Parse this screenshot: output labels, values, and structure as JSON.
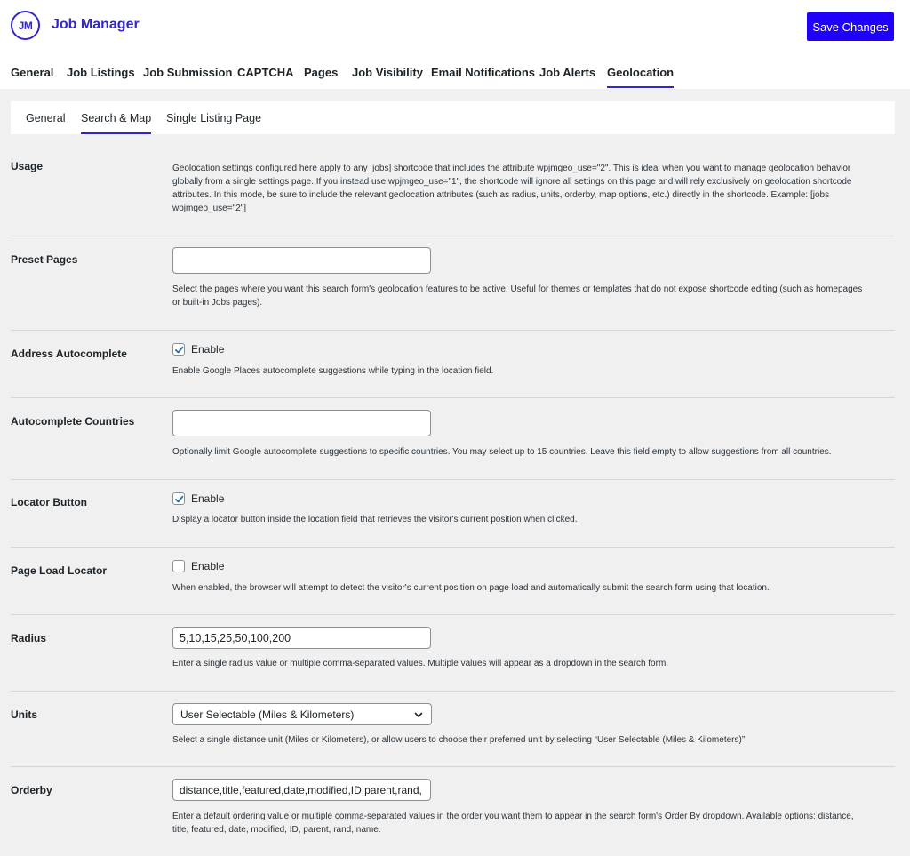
{
  "header": {
    "logo_text": "JM",
    "app_title": "Job Manager",
    "save_label": "Save Changes"
  },
  "main_tabs": [
    "General",
    "Job Listings",
    "Job Submission",
    "CAPTCHA",
    "Pages",
    "Job Visibility",
    "Email Notifications",
    "Job Alerts",
    "Geolocation"
  ],
  "main_tabs_active": "Geolocation",
  "sub_tabs": [
    "General",
    "Search & Map",
    "Single Listing Page"
  ],
  "sub_tabs_active": "Search & Map",
  "colors": {
    "accent": "#3126c9",
    "button": "#1f00ff",
    "checkbox": "#2271b1"
  },
  "settings": {
    "usage": {
      "label": "Usage",
      "description": "Geolocation settings configured here apply to any [jobs] shortcode that includes the attribute wpjmgeo_use=\"2\". This is ideal when you want to manage geolocation behavior globally from a single settings page. If you instead use wpjmgeo_use=\"1\", the shortcode will ignore all settings on this page and will rely exclusively on geolocation shortcode attributes. In this mode, be sure to include the relevant geolocation attributes (such as radius, units, orderby, map options, etc.) directly in the shortcode. Example: [jobs wpjmgeo_use=\"2\"]"
    },
    "preset_pages": {
      "label": "Preset Pages",
      "value": "",
      "description": "Select the pages where you want this search form's geolocation features to be active. Useful for themes or templates that do not expose shortcode editing (such as homepages or built-in Jobs pages)."
    },
    "address_autocomplete": {
      "label": "Address Autocomplete",
      "checked": true,
      "check_label": "Enable",
      "description": "Enable Google Places autocomplete suggestions while typing in the location field."
    },
    "autocomplete_countries": {
      "label": "Autocomplete Countries",
      "value": "",
      "description": "Optionally limit Google autocomplete suggestions to specific countries. You may select up to 15 countries. Leave this field empty to allow suggestions from all countries."
    },
    "locator_button": {
      "label": "Locator Button",
      "checked": true,
      "check_label": "Enable",
      "description": "Display a locator button inside the location field that retrieves the visitor's current position when clicked."
    },
    "page_load_locator": {
      "label": "Page Load Locator",
      "checked": false,
      "check_label": "Enable",
      "description": "When enabled, the browser will attempt to detect the visitor's current position on page load and automatically submit the search form using that location."
    },
    "radius": {
      "label": "Radius",
      "value": "5,10,15,25,50,100,200",
      "description": "Enter a single radius value or multiple comma-separated values. Multiple values will appear as a dropdown in the search form."
    },
    "units": {
      "label": "Units",
      "selected": "User Selectable (Miles & Kilometers)",
      "description": "Select a single distance unit (Miles or Kilometers), or allow users to choose their preferred unit by selecting “User Selectable (Miles & Kilometers)”."
    },
    "orderby": {
      "label": "Orderby",
      "value": "distance,title,featured,date,modified,ID,parent,rand,",
      "description": "Enter a default ordering value or multiple comma-separated values in the order you want them to appear in the search form's Order By dropdown. Available options: distance, title, featured, date, modified, ID, parent, rand, name."
    }
  }
}
